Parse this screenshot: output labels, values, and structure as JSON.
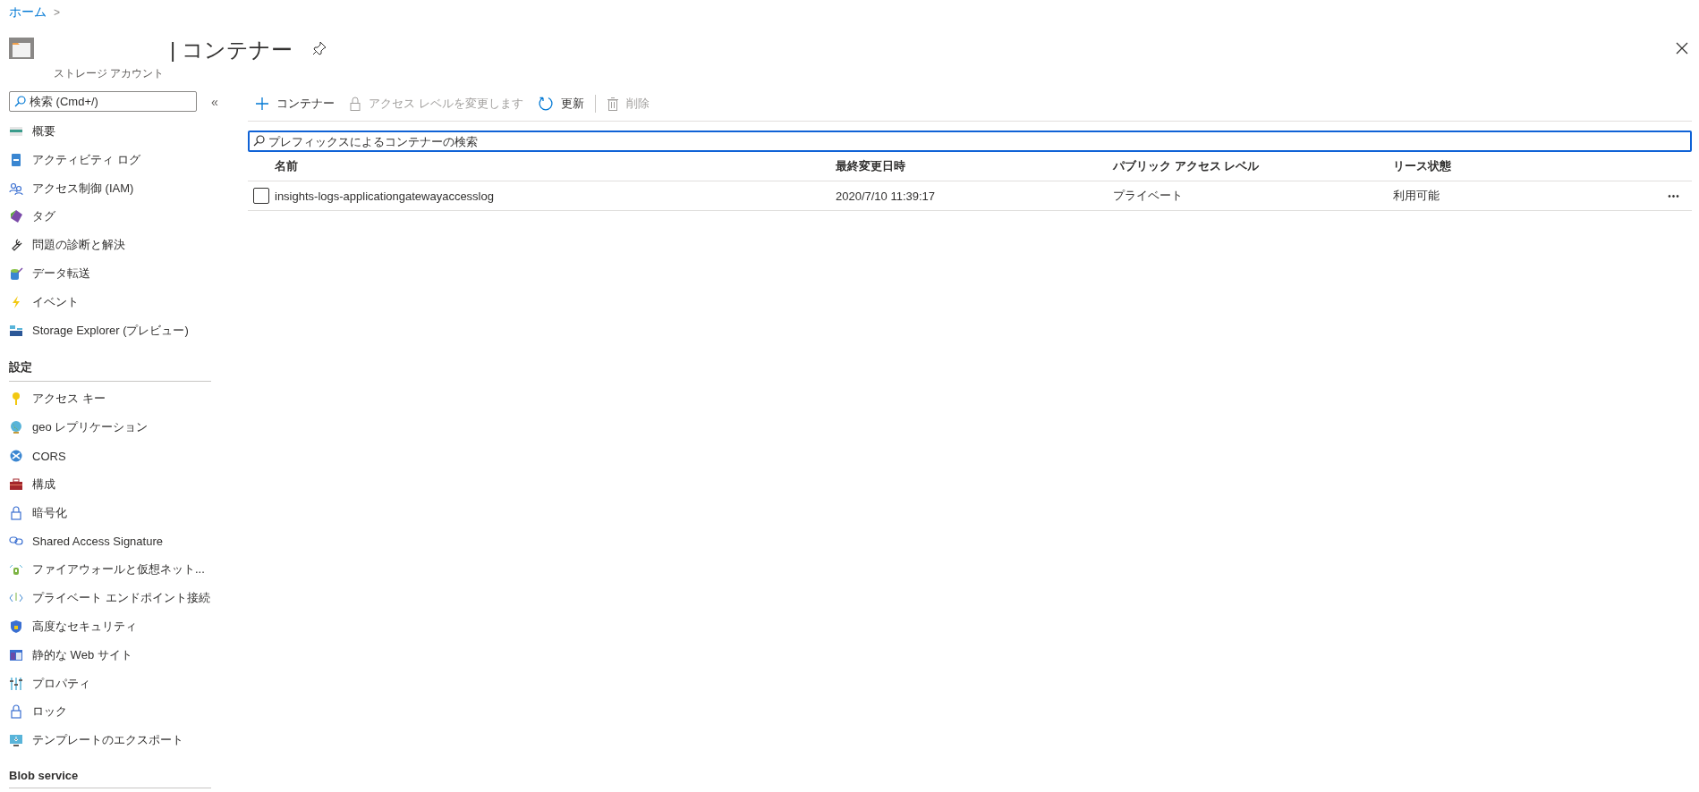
{
  "breadcrumb": {
    "items": [
      "ホーム"
    ],
    "separator": ">"
  },
  "header": {
    "title": "| コンテナー",
    "subtitle": "ストレージ アカウント"
  },
  "sidebar": {
    "search": {
      "placeholder": "検索 (Cmd+/)"
    },
    "collapse": "«",
    "sections": [
      {
        "items": [
          "概要",
          "アクティビティ ログ",
          "アクセス制御 (IAM)",
          "タグ",
          "問題の診断と解決",
          "データ転送",
          "イベント",
          "Storage Explorer (プレビュー)"
        ]
      },
      {
        "title": "設定",
        "items": [
          "アクセス キー",
          "geo レプリケーション",
          "CORS",
          "構成",
          "暗号化",
          "Shared Access Signature",
          "ファイアウォールと仮想ネット...",
          "プライベート エンドポイント接続",
          "高度なセキュリティ",
          "静的な Web サイト",
          "プロパティ",
          "ロック",
          "テンプレートのエクスポート"
        ]
      },
      {
        "title": "Blob service"
      }
    ]
  },
  "toolbar": [
    {
      "kind": "add",
      "label": "コンテナー",
      "disabled": false
    },
    {
      "kind": "lock",
      "label": "アクセス レベルを変更します",
      "disabled": true
    },
    {
      "kind": "refresh",
      "label": "更新",
      "disabled": false
    },
    {
      "kind": "delete",
      "label": "削除",
      "disabled": true
    }
  ],
  "filter": {
    "placeholder": "プレフィックスによるコンテナーの検索"
  },
  "table": {
    "columns": [
      "名前",
      "最終変更日時",
      "パブリック アクセス レベル",
      "リース状態"
    ],
    "rows": [
      {
        "checked": false,
        "cells": [
          "insights-logs-applicationgatewayaccesslog",
          "2020/7/10 11:39:17",
          "プライベート",
          "利用可能"
        ],
        "more": "•••"
      }
    ]
  }
}
